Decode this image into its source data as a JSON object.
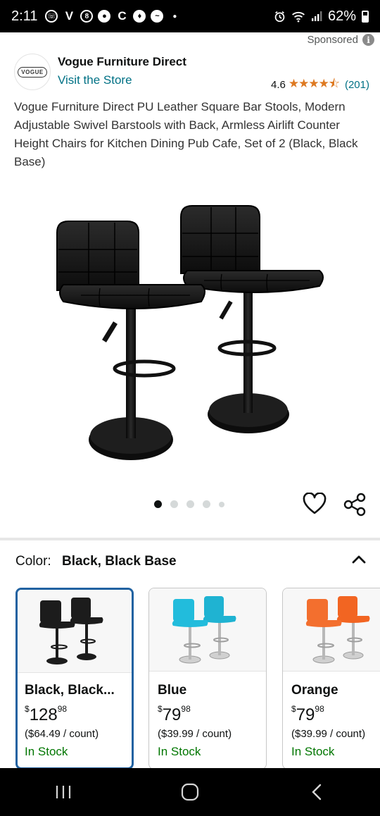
{
  "status_bar": {
    "time": "2:11",
    "battery": "62%",
    "notification_icons": [
      "phone-chat-icon",
      "v-icon",
      "badge-icon",
      "messaging-icon",
      "c-icon",
      "shield-icon",
      "messenger-icon",
      "dot-icon"
    ],
    "right_icons": [
      "alarm-icon",
      "wifi-icon",
      "signal-icon",
      "battery-icon"
    ]
  },
  "ad": {
    "sponsored_label": "Sponsored"
  },
  "brand": {
    "logo_text": "VOGUE",
    "name": "Vogue Furniture Direct",
    "visit_store": "Visit the Store",
    "rating_value": "4.6",
    "rating_stars": 4.6,
    "rating_count": "(201)"
  },
  "product": {
    "title": "Vogue Furniture Direct PU Leather Square Bar Stools, Modern Adjustable Swivel Barstools with Back, Armless Airlift Counter Height Chairs for Kitchen Dining Pub Cafe, Set of 2 (Black, Black Base)",
    "image_count": 5,
    "active_image_index": 0
  },
  "color_selector": {
    "label": "Color:",
    "selected_value": "Black, Black Base",
    "accent_color": "#2162a1"
  },
  "variants": [
    {
      "name": "Black, Black...",
      "price_symbol": "$",
      "price_whole": "128",
      "price_fraction": "98",
      "unit_price": "($64.49 / count)",
      "stock": "In Stock",
      "color": "#1c1c1c",
      "selected": true
    },
    {
      "name": "Blue",
      "price_symbol": "$",
      "price_whole": "79",
      "price_fraction": "98",
      "unit_price": "($39.99 / count)",
      "stock": "In Stock",
      "color": "#1fb3d2",
      "selected": false
    },
    {
      "name": "Orange",
      "price_symbol": "$",
      "price_whole": "79",
      "price_fraction": "98",
      "unit_price": "($39.99 / count)",
      "stock": "In Stock",
      "color": "#f26522",
      "selected": false
    }
  ],
  "nav_bar": {
    "buttons": [
      "recents-icon",
      "home-icon",
      "back-icon"
    ]
  }
}
